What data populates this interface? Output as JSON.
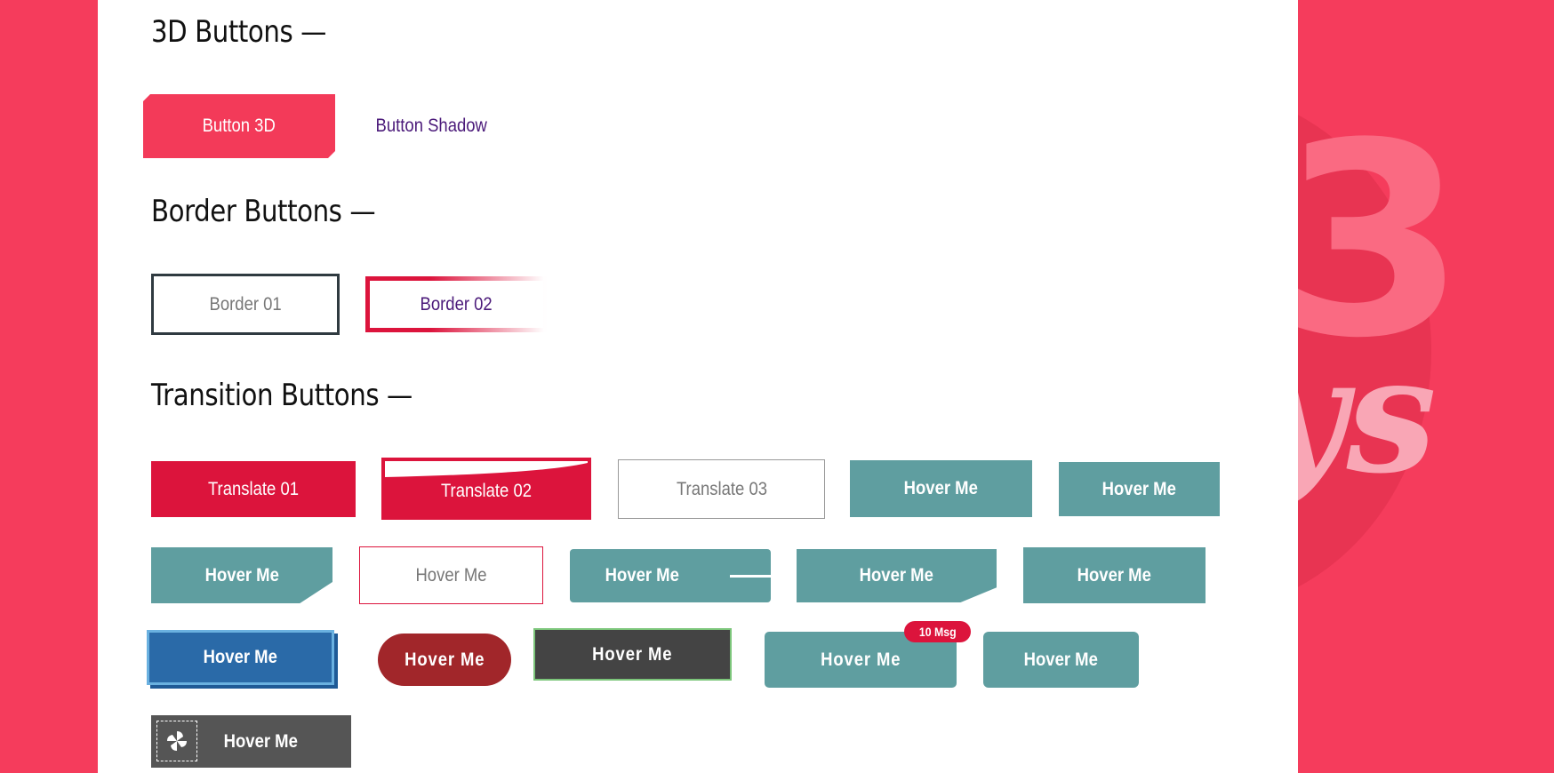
{
  "colors": {
    "background": "#f53c5c",
    "panel": "#ffffff",
    "accent_pink": "#f33a59",
    "crimson": "#dc143c",
    "teal": "#5f9ea0",
    "purple": "#4b1a7a",
    "blue": "#2a6aa8",
    "dark_red": "#a1262a",
    "dark_gray": "#444444"
  },
  "background_art": {
    "text_number": "3",
    "text_script": "ys"
  },
  "sections": {
    "three_d": {
      "title": "3D Buttons —",
      "buttons": [
        "Button 3D",
        "Button Shadow"
      ]
    },
    "border": {
      "title": "Border Buttons —",
      "buttons": [
        "Border 01",
        "Border 02"
      ]
    },
    "transition": {
      "title": "Transition Buttons —",
      "row1": [
        "Translate 01",
        "Translate 02",
        "Translate 03",
        "Hover Me",
        "Hover Me"
      ],
      "row2": [
        "Hover Me",
        "Hover Me",
        "Hover Me",
        "Hover Me",
        "Hover Me"
      ],
      "row3": [
        "Hover Me",
        "Hover Me",
        "Hover Me",
        "Hover Me",
        "Hover Me"
      ],
      "badge": "10 Msg",
      "row4": [
        "Hover Me"
      ],
      "row4_icon": "pinwheel-icon"
    }
  }
}
